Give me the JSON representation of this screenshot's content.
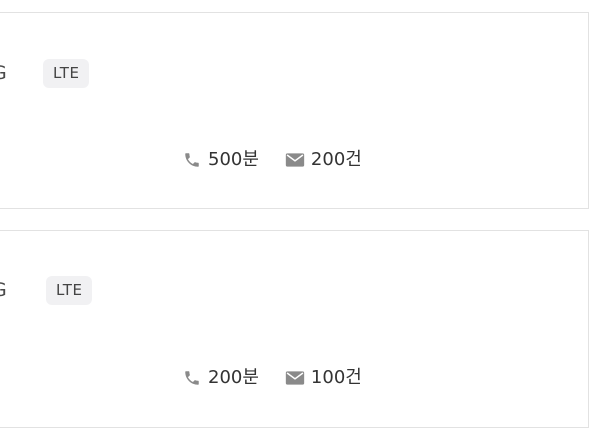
{
  "plans": [
    {
      "network_prefix": "G",
      "badge": "LTE",
      "voice": {
        "icon": "phone-icon",
        "value": "500분"
      },
      "message": {
        "icon": "mail-icon",
        "value": "200건"
      }
    },
    {
      "network_prefix": "G",
      "badge": "LTE",
      "voice": {
        "icon": "phone-icon",
        "value": "200분"
      },
      "message": {
        "icon": "mail-icon",
        "value": "100건"
      }
    }
  ],
  "colors": {
    "icon": "#8a8a8a",
    "badge_bg": "#f1f1f3",
    "divider": "#e2e2e2"
  }
}
